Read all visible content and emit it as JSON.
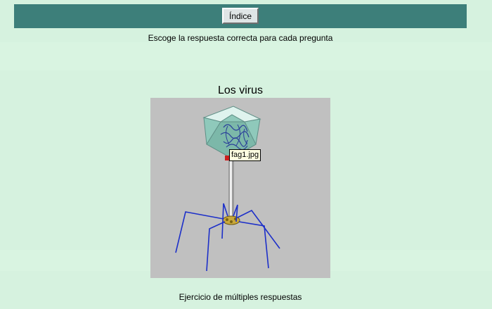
{
  "topbar": {
    "index_label": "Índice"
  },
  "instructions": "Escoge la respuesta correcta para cada pregunta",
  "title": "Los virus",
  "image": {
    "tooltip": "fag1.jpg"
  },
  "footer": "Ejercicio de múltiples respuestas",
  "colors": {
    "page_bg": "#d6f2df",
    "topbar": "#3d7f7a",
    "figure_bg": "#c0c0c0"
  }
}
